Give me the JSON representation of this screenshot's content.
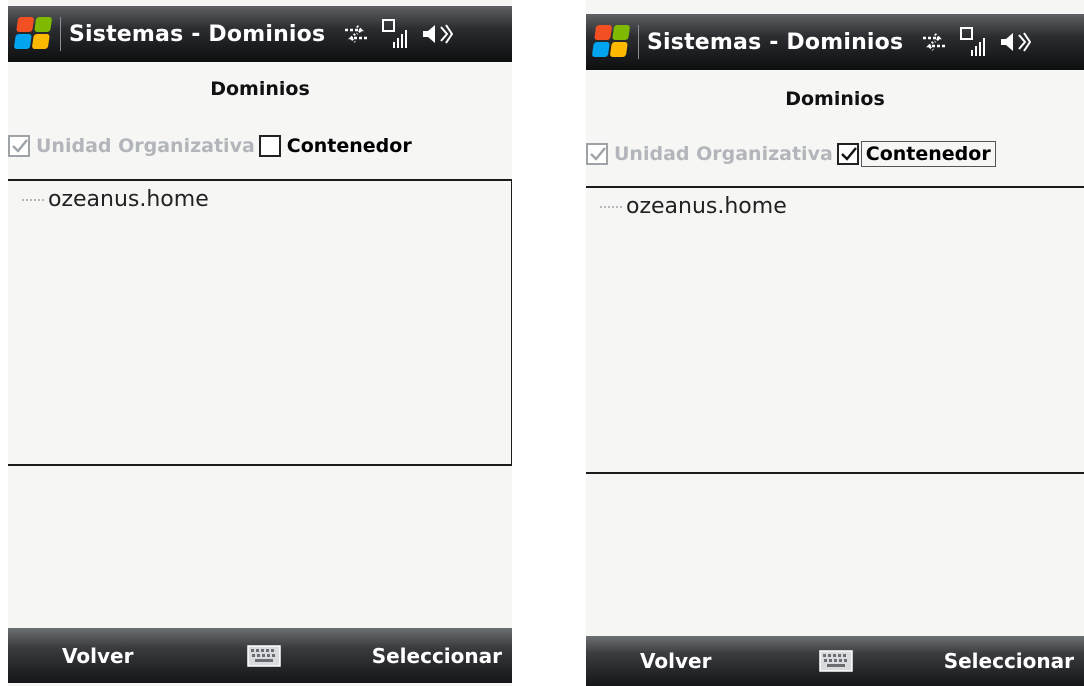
{
  "screens": [
    {
      "title": "Sistemas - Dominios",
      "heading": "Dominios",
      "checkbox_ou": {
        "label": "Unidad Organizativa",
        "checked": true,
        "enabled": false
      },
      "checkbox_container": {
        "label": "Contenedor",
        "checked": false,
        "enabled": true
      },
      "tree_items": [
        "ozeanus.home"
      ],
      "softkeys": {
        "left": "Volver",
        "right": "Seleccionar"
      },
      "icons": [
        "windows-start-icon",
        "data-sync-icon",
        "signal-strength-icon",
        "speaker-icon",
        "keyboard-icon"
      ]
    },
    {
      "title": "Sistemas - Dominios",
      "heading": "Dominios",
      "checkbox_ou": {
        "label": "Unidad Organizativa",
        "checked": true,
        "enabled": false
      },
      "checkbox_container": {
        "label": "Contenedor",
        "checked": true,
        "enabled": true
      },
      "tree_items": [
        "ozeanus.home"
      ],
      "softkeys": {
        "left": "Volver",
        "right": "Seleccionar"
      },
      "icons": [
        "windows-start-icon",
        "data-sync-icon",
        "signal-strength-icon",
        "speaker-icon",
        "keyboard-icon"
      ]
    }
  ],
  "colors": {
    "titlebar": "#0d0e10",
    "background": "#f6f7f5",
    "disabled_text": "#b2b6ba"
  }
}
